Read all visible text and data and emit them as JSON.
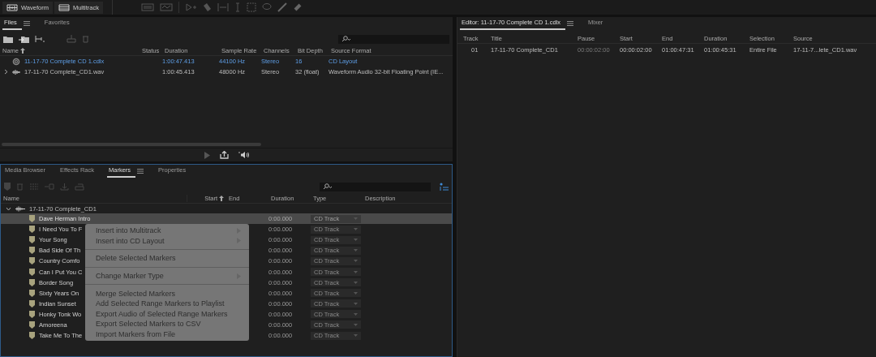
{
  "workspace_tabs": [
    {
      "label": "Waveform",
      "kind": "waveform",
      "selected": false
    },
    {
      "label": "Multitrack",
      "kind": "multitrack",
      "selected": false
    }
  ],
  "files_panel": {
    "tabs": [
      {
        "label": "Files",
        "selected": true
      },
      {
        "label": "Favorites",
        "selected": false
      }
    ],
    "columns": [
      "Name",
      "Status",
      "Duration",
      "Sample Rate",
      "Channels",
      "Bit Depth",
      "Source Format"
    ],
    "rows": [
      {
        "kind": "cd",
        "active": true,
        "expandable": false,
        "cells": [
          "11-17-70 Complete CD 1.cdlx",
          "",
          "1:00:47.413",
          "44100 Hz",
          "Stereo",
          "16",
          "CD Layout"
        ]
      },
      {
        "kind": "wave",
        "active": false,
        "expandable": true,
        "cells": [
          "17-11-70 Complete_CD1.wav",
          "",
          "1:00:45.413",
          "48000 Hz",
          "Stereo",
          "32 (float)",
          "Waveform Audio 32-bit Floating Point (IE..."
        ]
      }
    ]
  },
  "editor_panel": {
    "tabs": [
      {
        "label": "Editor: 11-17-70 Complete CD 1.cdlx",
        "selected": true
      },
      {
        "label": "Mixer",
        "selected": false
      }
    ],
    "columns": [
      "Track",
      "Title",
      "Pause",
      "Start",
      "End",
      "Duration",
      "Selection",
      "Source"
    ],
    "rows": [
      {
        "cells": [
          "01",
          "17-11-70 Complete_CD1",
          "00:00:02:00",
          "00:00:02:00",
          "01:00:47:31",
          "01:00:45:31",
          "Entire File",
          "17-11-7...lete_CD1.wav"
        ]
      }
    ]
  },
  "markers_panel": {
    "tabs": [
      {
        "label": "Media Browser",
        "selected": false
      },
      {
        "label": "Effects Rack",
        "selected": false
      },
      {
        "label": "Markers",
        "selected": true
      },
      {
        "label": "Properties",
        "selected": false
      }
    ],
    "columns": [
      "Name",
      "Start",
      "End",
      "Duration",
      "Type",
      "Description"
    ],
    "group": {
      "name": "17-11-70 Complete_CD1",
      "expanded": true
    },
    "rows": [
      {
        "name": "Dave Herman Intro",
        "duration": "0:00.000",
        "type": "CD Track",
        "selected": true
      },
      {
        "name": "I Need You To F",
        "duration": "0:00.000",
        "type": "CD Track",
        "selected": false
      },
      {
        "name": "Your Song",
        "duration": "0:00.000",
        "type": "CD Track",
        "selected": false
      },
      {
        "name": "Bad Side Of Th",
        "duration": "0:00.000",
        "type": "CD Track",
        "selected": false
      },
      {
        "name": "Country Comfo",
        "duration": "0:00.000",
        "type": "CD Track",
        "selected": false
      },
      {
        "name": "Can I Put You C",
        "duration": "0:00.000",
        "type": "CD Track",
        "selected": false
      },
      {
        "name": "Border Song",
        "duration": "0:00.000",
        "type": "CD Track",
        "selected": false
      },
      {
        "name": "Sixty Years On",
        "duration": "0:00.000",
        "type": "CD Track",
        "selected": false
      },
      {
        "name": "Indian Sunset",
        "duration": "0:00.000",
        "type": "CD Track",
        "selected": false
      },
      {
        "name": "Honky Tonk Wo",
        "duration": "0:00.000",
        "type": "CD Track",
        "selected": false
      },
      {
        "name": "Amoreena",
        "duration": "0:00.000",
        "type": "CD Track",
        "selected": false
      },
      {
        "name": "Take Me To The",
        "duration": "0:00.000",
        "type": "CD Track",
        "selected": false
      }
    ]
  },
  "context_menu": [
    {
      "kind": "item",
      "label": "Insert into Multitrack",
      "submenu": true,
      "disabled": true
    },
    {
      "kind": "item",
      "label": "Insert into CD Layout",
      "submenu": true,
      "disabled": true
    },
    {
      "kind": "separator"
    },
    {
      "kind": "item",
      "label": "Delete Selected Markers",
      "submenu": false,
      "disabled": true
    },
    {
      "kind": "separator"
    },
    {
      "kind": "item",
      "label": "Change Marker Type",
      "submenu": true,
      "disabled": true
    },
    {
      "kind": "separator"
    },
    {
      "kind": "item",
      "label": "Merge Selected Markers",
      "submenu": false,
      "disabled": true
    },
    {
      "kind": "item",
      "label": "Add Selected Range Markers to Playlist",
      "submenu": false,
      "disabled": true
    },
    {
      "kind": "item",
      "label": "Export Audio of Selected Range Markers",
      "submenu": false,
      "disabled": true
    },
    {
      "kind": "item",
      "label": "Export Selected Markers to CSV",
      "submenu": false,
      "disabled": true
    },
    {
      "kind": "item",
      "label": "Import Markers from File",
      "submenu": false,
      "disabled": true
    }
  ]
}
